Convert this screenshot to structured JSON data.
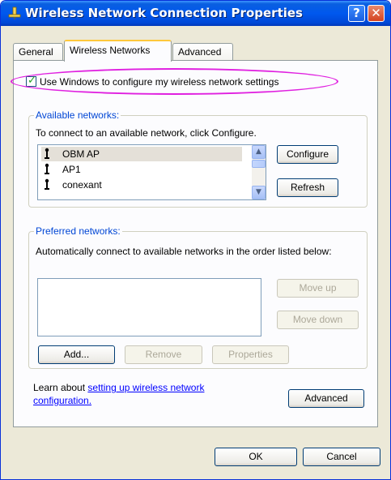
{
  "window": {
    "title": "Wireless Network Connection Properties",
    "help_glyph": "?",
    "close_glyph": "✕"
  },
  "tabs": [
    {
      "label": "General",
      "active": false
    },
    {
      "label": "Wireless Networks",
      "active": true
    },
    {
      "label": "Advanced",
      "active": false
    }
  ],
  "use_windows": {
    "checked": true,
    "label": "Use Windows to configure my wireless network settings"
  },
  "available": {
    "group_title": "Available networks:",
    "instruction": "To connect to an available network, click Configure.",
    "networks": [
      {
        "name": "OBM AP",
        "selected": true
      },
      {
        "name": "AP1",
        "selected": false
      },
      {
        "name": "conexant",
        "selected": false
      }
    ],
    "configure_label": "Configure",
    "refresh_label": "Refresh"
  },
  "preferred": {
    "group_title": "Preferred networks:",
    "instruction": "Automatically connect to available networks in the order listed below:",
    "move_up_label": "Move up",
    "move_down_label": "Move down",
    "add_label": "Add...",
    "remove_label": "Remove",
    "properties_label": "Properties"
  },
  "learn": {
    "prefix": "Learn about ",
    "link_line1": "setting up wireless network",
    "link_line2": "configuration."
  },
  "advanced_label": "Advanced",
  "ok_label": "OK",
  "cancel_label": "Cancel",
  "colors": {
    "titlebar": "#0058ee",
    "group_title": "#0046d5",
    "highlight": "#e020e0",
    "link": "#0000ff"
  }
}
